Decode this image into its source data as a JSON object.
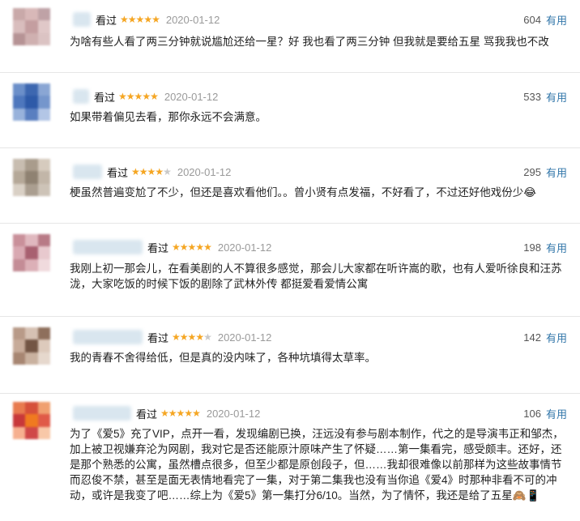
{
  "seen_label": "看过",
  "useful_label": "有用",
  "reviews": [
    {
      "date": "2020-01-12",
      "stars": 5,
      "votes": "604",
      "content": "为啥有些人看了两三分钟就说尴尬还给一星？好 我也看了两三分钟 但我就是要给五星 骂我我也不改"
    },
    {
      "date": "2020-01-12",
      "stars": 5,
      "votes": "533",
      "content": "如果带着偏见去看，那你永远不会满意。"
    },
    {
      "date": "2020-01-12",
      "stars": 4,
      "votes": "295",
      "content": "梗虽然普遍变尬了不少，但还是喜欢看他们。。曾小贤有点发福，不好看了，不过还好他戏份少😂"
    },
    {
      "date": "2020-01-12",
      "stars": 5,
      "votes": "198",
      "content": "我刚上初一那会儿，在看美剧的人不算很多感觉，那会儿大家都在听许嵩的歌，也有人爱听徐良和汪苏泷，大家吃饭的时候下饭的剧除了武林外传 都挺爱看爱情公寓"
    },
    {
      "date": "2020-01-12",
      "stars": 4,
      "votes": "142",
      "content": "我的青春不舍得给低，但是真的没内味了，各种坑填得太草率。"
    },
    {
      "date": "2020-01-12",
      "stars": 5,
      "votes": "106",
      "content": "为了《爱5》充了VIP，点开一看，发现编剧已换，汪远没有参与剧本制作，代之的是导演韦正和邹杰，加上被卫视嫌弃沦为网剧，我对它是否还能原汁原味产生了怀疑……第一集看完，感受颇丰。还好，还是那个熟悉的公寓，虽然槽点很多，但至少都是原创段子，但……我却很难像以前那样为这些故事情节而忍俊不禁，甚至是面无表情地看完了一集，对于第二集我也没有当你追《爱4》时那种非看不可的冲动，或许是我变了吧……综上为《爱5》第一集打分6/10。当然，为了情怀，我还是给了五星🙈📱"
    }
  ],
  "colors": {
    "accent": "#3377aa",
    "star": "#f5a623",
    "date": "#9a9a9a"
  }
}
